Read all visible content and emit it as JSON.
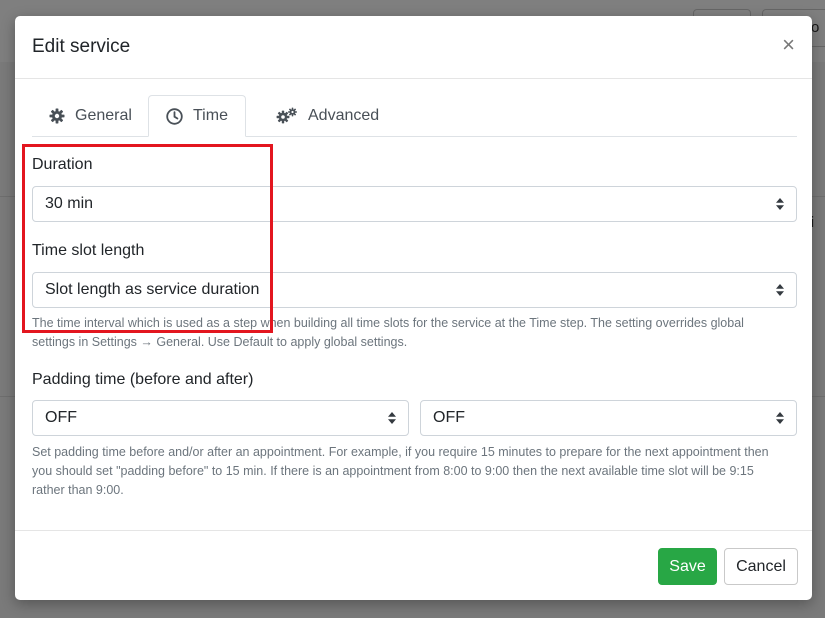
{
  "background": {
    "partial_button_text": "o",
    "partial_side_text": "ti"
  },
  "modal": {
    "title": "Edit service",
    "close_symbol": "×"
  },
  "tabs": [
    {
      "label": "General",
      "icon": "gear-icon",
      "active": false
    },
    {
      "label": "Time",
      "icon": "clock-icon",
      "active": true
    },
    {
      "label": "Advanced",
      "icon": "gears-icon",
      "active": false
    }
  ],
  "duration": {
    "label": "Duration",
    "value": "30 min"
  },
  "time_slot": {
    "label": "Time slot length",
    "value": "Slot length as service duration",
    "help_line1": "The time interval which is used as a step when building all time slots for the service at the Time step. The setting overrides global",
    "help_line2": "settings in Settings → General. Use Default to apply global settings."
  },
  "padding": {
    "label": "Padding time (before and after)",
    "before_value": "OFF",
    "after_value": "OFF",
    "help_line1": "Set padding time before and/or after an appointment. For example, if you require 15 minutes to prepare for the next appointment then",
    "help_line2": "you should set \"padding before\" to 15 min. If there is an appointment from 8:00 to 9:00 then the next available time slot will be 9:15",
    "help_line3": "rather than 9:00."
  },
  "footer": {
    "save_label": "Save",
    "cancel_label": "Cancel"
  },
  "colors": {
    "save_button": "#28a745",
    "highlight_box": "#e3161f"
  }
}
